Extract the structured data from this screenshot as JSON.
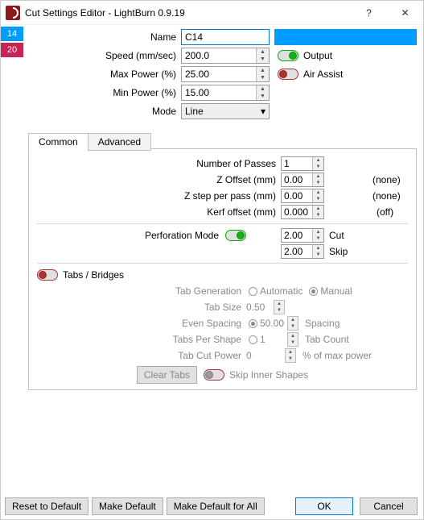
{
  "window": {
    "title": "Cut Settings Editor - LightBurn 0.9.19"
  },
  "layers": [
    {
      "num": "14",
      "color": "#009cff"
    },
    {
      "num": "20",
      "color": "#c82456"
    }
  ],
  "top": {
    "name_label": "Name",
    "name_value": "C14",
    "speed_label": "Speed (mm/sec)",
    "speed_value": "200.0",
    "maxp_label": "Max Power (%)",
    "maxp_value": "25.00",
    "minp_label": "Min Power (%)",
    "minp_value": "15.00",
    "mode_label": "Mode",
    "mode_value": "Line",
    "output_label": "Output",
    "air_label": "Air Assist"
  },
  "tabs": {
    "common": "Common",
    "advanced": "Advanced"
  },
  "common": {
    "passes_label": "Number of Passes",
    "passes_value": "1",
    "zoff_label": "Z Offset (mm)",
    "zoff_value": "0.00",
    "zoff_right": "(none)",
    "zstep_label": "Z step per pass (mm)",
    "zstep_value": "0.00",
    "zstep_right": "(none)",
    "kerf_label": "Kerf offset (mm)",
    "kerf_value": "0.000",
    "kerf_right": "(off)",
    "perf_label": "Perforation Mode",
    "perf_cut_value": "2.00",
    "perf_cut_label": "Cut",
    "perf_skip_value": "2.00",
    "perf_skip_label": "Skip",
    "tabs_bridges": "Tabs / Bridges",
    "tabgen_label": "Tab Generation",
    "tabgen_auto": "Automatic",
    "tabgen_manual": "Manual",
    "tabsize_label": "Tab Size",
    "tabsize_value": "0.50",
    "evensp_label": "Even Spacing",
    "evensp_value": "50.00",
    "evensp_right": "Spacing",
    "tps_label": "Tabs Per Shape",
    "tps_value": "1",
    "tps_right": "Tab Count",
    "tcp_label": "Tab Cut Power",
    "tcp_value": "0",
    "tcp_right": "% of max power",
    "clear_tabs": "Clear Tabs",
    "skip_inner": "Skip Inner Shapes"
  },
  "footer": {
    "reset": "Reset to Default",
    "mkdef": "Make Default",
    "mkdefall": "Make Default for All",
    "ok": "OK",
    "cancel": "Cancel"
  }
}
